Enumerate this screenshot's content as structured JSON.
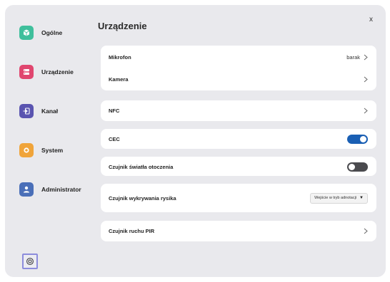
{
  "sidebar": {
    "items": [
      {
        "label": "Ogólne",
        "icon": "cube-icon",
        "color": "#3fbf9c"
      },
      {
        "label": "Urządzenie",
        "icon": "device-icon",
        "color": "#e0466f"
      },
      {
        "label": "Kanał",
        "icon": "input-icon",
        "color": "#5a54b0"
      },
      {
        "label": "System",
        "icon": "system-icon",
        "color": "#f0a43a"
      },
      {
        "label": "Administrator",
        "icon": "user-icon",
        "color": "#4a6fb8"
      }
    ],
    "settings_icon": "gear-icon"
  },
  "header": {
    "title": "Urządzenie",
    "close_label": "x"
  },
  "settings": {
    "mikrofon": {
      "label": "Mikrofon",
      "value": "barak"
    },
    "kamera": {
      "label": "Kamera"
    },
    "nfc": {
      "label": "NFC"
    },
    "cec": {
      "label": "CEC",
      "enabled": true
    },
    "light_sensor": {
      "label": "Czujnik światła otoczenia",
      "enabled": false
    },
    "pen_sensor": {
      "label": "Czujnik wykrywania rysika",
      "selected": "Wejście w tryb adnotacji"
    },
    "pir_sensor": {
      "label": "Czujnik ruchu PIR"
    }
  },
  "colors": {
    "toggle_on": "#1a5fb4",
    "toggle_off": "#4a4a4e",
    "panel_bg": "#e9e9ed"
  }
}
